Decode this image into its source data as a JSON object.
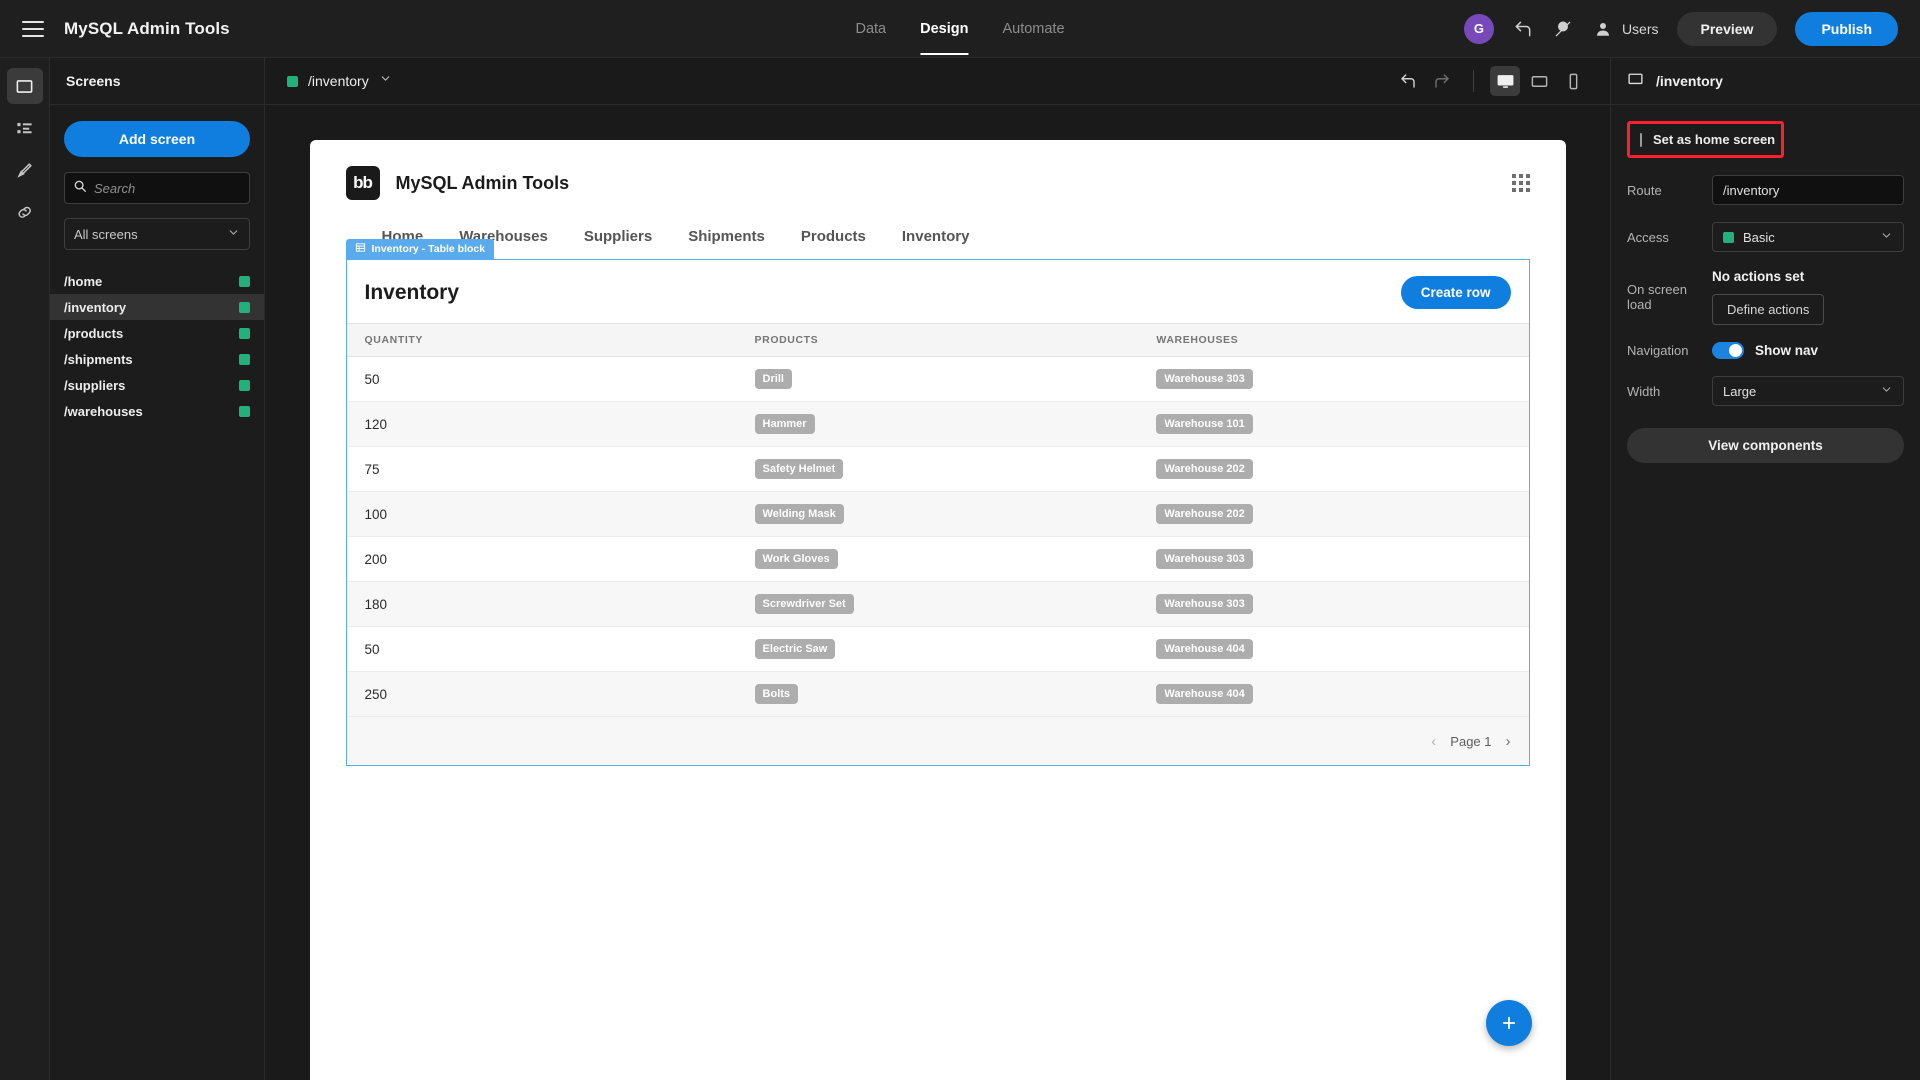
{
  "topbar": {
    "menu_icon": "hamburger-icon",
    "title": "MySQL Admin Tools",
    "tabs": [
      {
        "label": "Data",
        "active": false
      },
      {
        "label": "Design",
        "active": true
      },
      {
        "label": "Automate",
        "active": false
      }
    ],
    "avatar_initial": "G",
    "undo_icon": "undo-icon",
    "theme_icon": "theme-icon",
    "users_icon": "users-icon",
    "users_label": "Users",
    "preview_label": "Preview",
    "publish_label": "Publish",
    "publish_color": "#0f7ede"
  },
  "rail": [
    {
      "icon": "screens-icon",
      "active": true
    },
    {
      "icon": "components-list-icon",
      "active": false
    },
    {
      "icon": "theme-brush-icon",
      "active": false
    },
    {
      "icon": "links-icon",
      "active": false
    }
  ],
  "screens_panel": {
    "header": "Screens",
    "add_button": "Add screen",
    "search": {
      "value": "",
      "placeholder": "Search",
      "search_icon": "search-icon",
      "clear_icon": "clear-icon"
    },
    "filter": {
      "value": "All screens",
      "chevron": "chevron-down-icon"
    },
    "items": [
      {
        "label": "/home",
        "active": false,
        "status_color": "#22b07d"
      },
      {
        "label": "/inventory",
        "active": true,
        "status_color": "#22b07d"
      },
      {
        "label": "/products",
        "active": false,
        "status_color": "#22b07d"
      },
      {
        "label": "/shipments",
        "active": false,
        "status_color": "#22b07d"
      },
      {
        "label": "/suppliers",
        "active": false,
        "status_color": "#22b07d"
      },
      {
        "label": "/warehouses",
        "active": false,
        "status_color": "#22b07d"
      }
    ]
  },
  "canvas_bar": {
    "route": "/inventory",
    "route_color": "#22b07d",
    "chevron": "chevron-down-icon",
    "undo_icon": "undo-icon",
    "redo_icon": "redo-icon",
    "devices": [
      {
        "icon": "desktop-icon",
        "active": true
      },
      {
        "icon": "tablet-icon",
        "active": false
      },
      {
        "icon": "mobile-icon",
        "active": false
      }
    ]
  },
  "preview": {
    "logo_text": "bb",
    "app_name": "MySQL Admin Tools",
    "grid_icon": "apps-grid-icon",
    "nav": [
      "Home",
      "Warehouses",
      "Suppliers",
      "Shipments",
      "Products",
      "Inventory"
    ],
    "block_tag": {
      "icon": "table-block-icon",
      "label": "Inventory - Table block",
      "color": "#5aabee"
    },
    "table": {
      "title": "Inventory",
      "create_label": "Create row",
      "columns": [
        "QUANTITY",
        "PRODUCTS",
        "WAREHOUSES"
      ],
      "rows": [
        {
          "quantity": "50",
          "product": "Drill",
          "warehouse": "Warehouse 303"
        },
        {
          "quantity": "120",
          "product": "Hammer",
          "warehouse": "Warehouse 101"
        },
        {
          "quantity": "75",
          "product": "Safety Helmet",
          "warehouse": "Warehouse 202"
        },
        {
          "quantity": "100",
          "product": "Welding Mask",
          "warehouse": "Warehouse 202"
        },
        {
          "quantity": "200",
          "product": "Work Gloves",
          "warehouse": "Warehouse 303"
        },
        {
          "quantity": "180",
          "product": "Screwdriver Set",
          "warehouse": "Warehouse 303"
        },
        {
          "quantity": "50",
          "product": "Electric Saw",
          "warehouse": "Warehouse 404"
        },
        {
          "quantity": "250",
          "product": "Bolts",
          "warehouse": "Warehouse 404"
        }
      ],
      "page_label": "Page 1",
      "prev_icon": "chevron-left-icon",
      "next_icon": "chevron-right-icon"
    },
    "fab_icon": "plus-icon"
  },
  "inspector": {
    "icon": "screen-icon",
    "title": "/inventory",
    "home_screen": {
      "label": "Set as home screen",
      "checked": false,
      "highlight_color": "#fc1f2e"
    },
    "route": {
      "label": "Route",
      "value": "/inventory"
    },
    "access": {
      "label": "Access",
      "value": "Basic",
      "swatch": "#22b07d"
    },
    "on_screen_load": {
      "label": "On screen load",
      "value": "No actions set",
      "button": "Define actions"
    },
    "navigation": {
      "label": "Navigation",
      "toggle_label": "Show nav",
      "enabled": true
    },
    "width": {
      "label": "Width",
      "value": "Large"
    },
    "view_components": "View components"
  }
}
